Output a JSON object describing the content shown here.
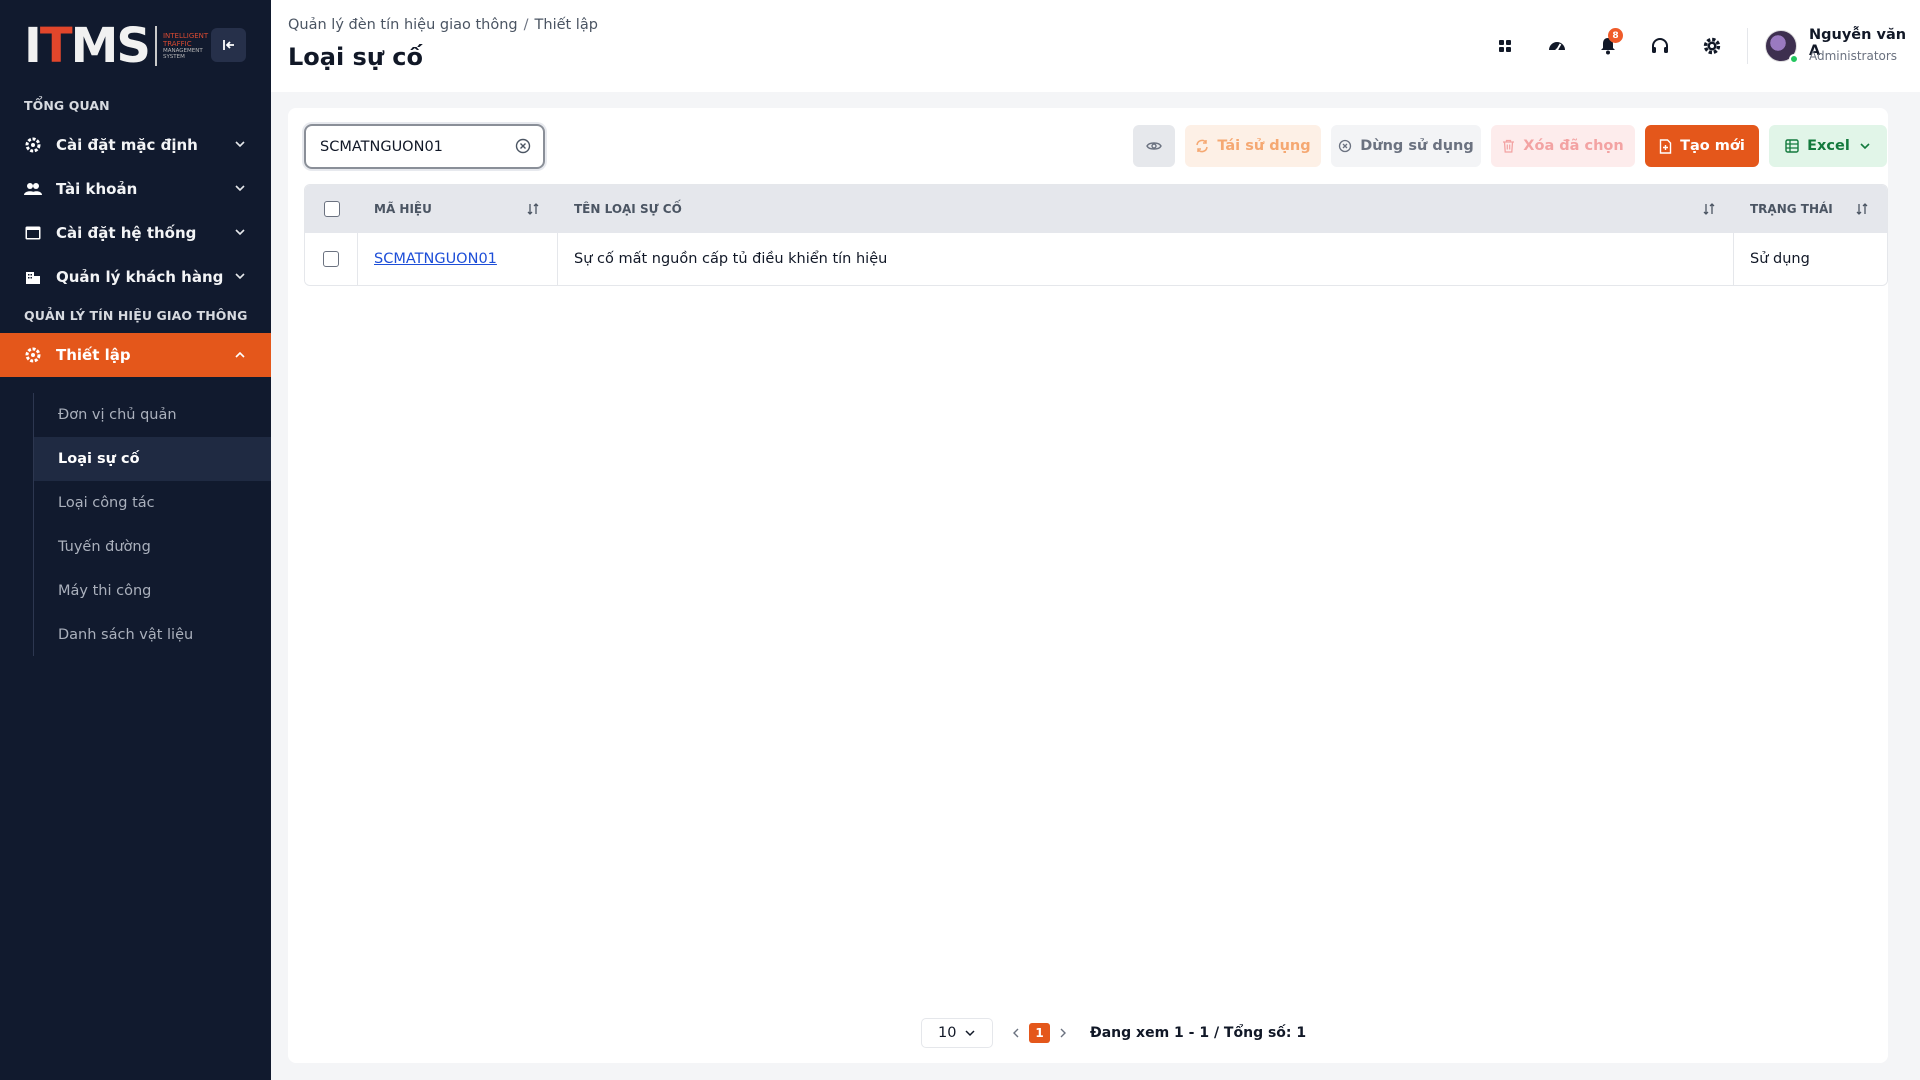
{
  "logo": {
    "mark": "ITMS",
    "sub_lines": [
      "INTELLIGENT",
      "TRAFFIC",
      "MANAGEMENT",
      "SYSTEM"
    ]
  },
  "sidebar": {
    "section_overview": "TỔNG QUAN",
    "items": [
      {
        "label": "Cài đặt mặc định",
        "icon": "gear-icon"
      },
      {
        "label": "Tài khoản",
        "icon": "users-icon"
      },
      {
        "label": "Cài đặt hệ thống",
        "icon": "window-icon"
      },
      {
        "label": "Quản lý khách hàng",
        "icon": "building-icon"
      }
    ],
    "section_traffic": "QUẢN LÝ TÍN HIỆU GIAO THÔNG",
    "active_item": {
      "label": "Thiết lập",
      "icon": "gear-icon"
    },
    "sub_items": [
      {
        "label": "Đơn vị chủ quản"
      },
      {
        "label": "Loại sự cố"
      },
      {
        "label": "Loại công tác"
      },
      {
        "label": "Tuyến đường"
      },
      {
        "label": "Máy thi công"
      },
      {
        "label": "Danh sách vật liệu"
      }
    ],
    "active_sub_index": 1
  },
  "header": {
    "breadcrumb": [
      "Quản lý đèn tín hiệu giao thông",
      "Thiết lập"
    ],
    "breadcrumb_sep": "/",
    "title": "Loại sự cố",
    "notification_count": "8",
    "user": {
      "name": "Nguyễn văn A",
      "role": "Administrators"
    }
  },
  "toolbar": {
    "search_value": "SCMATNGUON01",
    "reuse_label": "Tái sử dụng",
    "stop_label": "Dừng sử dụng",
    "delete_label": "Xóa đã chọn",
    "create_label": "Tạo mới",
    "excel_label": "Excel"
  },
  "table": {
    "columns": [
      "MÃ HIỆU",
      "TÊN LOẠI SỰ CỐ",
      "TRẠNG THÁI"
    ],
    "rows": [
      {
        "code": "SCMATNGUON01",
        "name": "Sự cố mất nguồn cấp tủ điều khiển tín hiệu",
        "status": "Sử dụng"
      }
    ]
  },
  "pagination": {
    "page_size": "10",
    "current_page": "1",
    "info": "Đang xem 1 - 1 / Tổng số: 1"
  },
  "colors": {
    "accent": "#e4571b",
    "sidebar_bg": "#111a2e",
    "link": "#1d4ed8"
  }
}
